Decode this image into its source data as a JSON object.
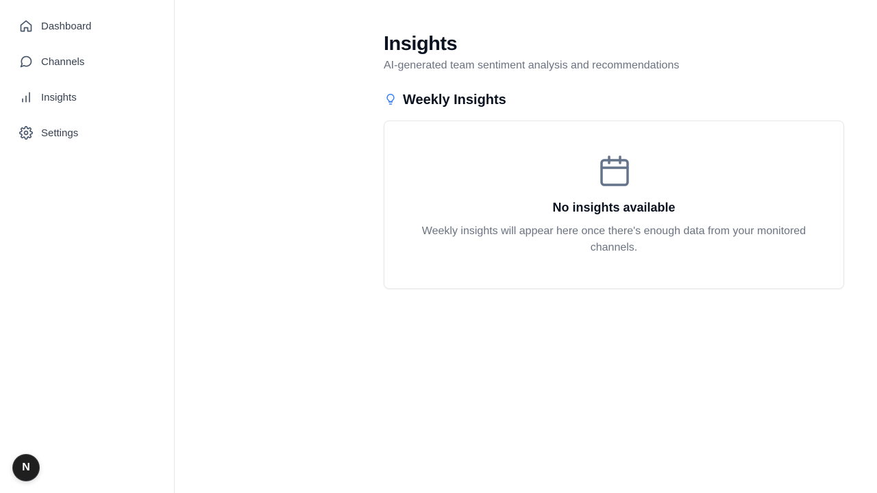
{
  "sidebar": {
    "items": [
      {
        "label": "Dashboard",
        "icon": "home-icon"
      },
      {
        "label": "Channels",
        "icon": "message-circle-icon"
      },
      {
        "label": "Insights",
        "icon": "bar-chart-icon"
      },
      {
        "label": "Settings",
        "icon": "gear-icon"
      }
    ],
    "avatar": {
      "initial": "N"
    }
  },
  "header": {
    "title": "Insights",
    "subtitle": "AI-generated team sentiment analysis and recommendations"
  },
  "section": {
    "title": "Weekly Insights",
    "icon": "lightbulb-icon",
    "icon_color": "#3b82f6"
  },
  "empty_state": {
    "icon": "calendar-icon",
    "title": "No insights available",
    "description": "Weekly insights will appear here once there's enough data from your monitored channels."
  }
}
